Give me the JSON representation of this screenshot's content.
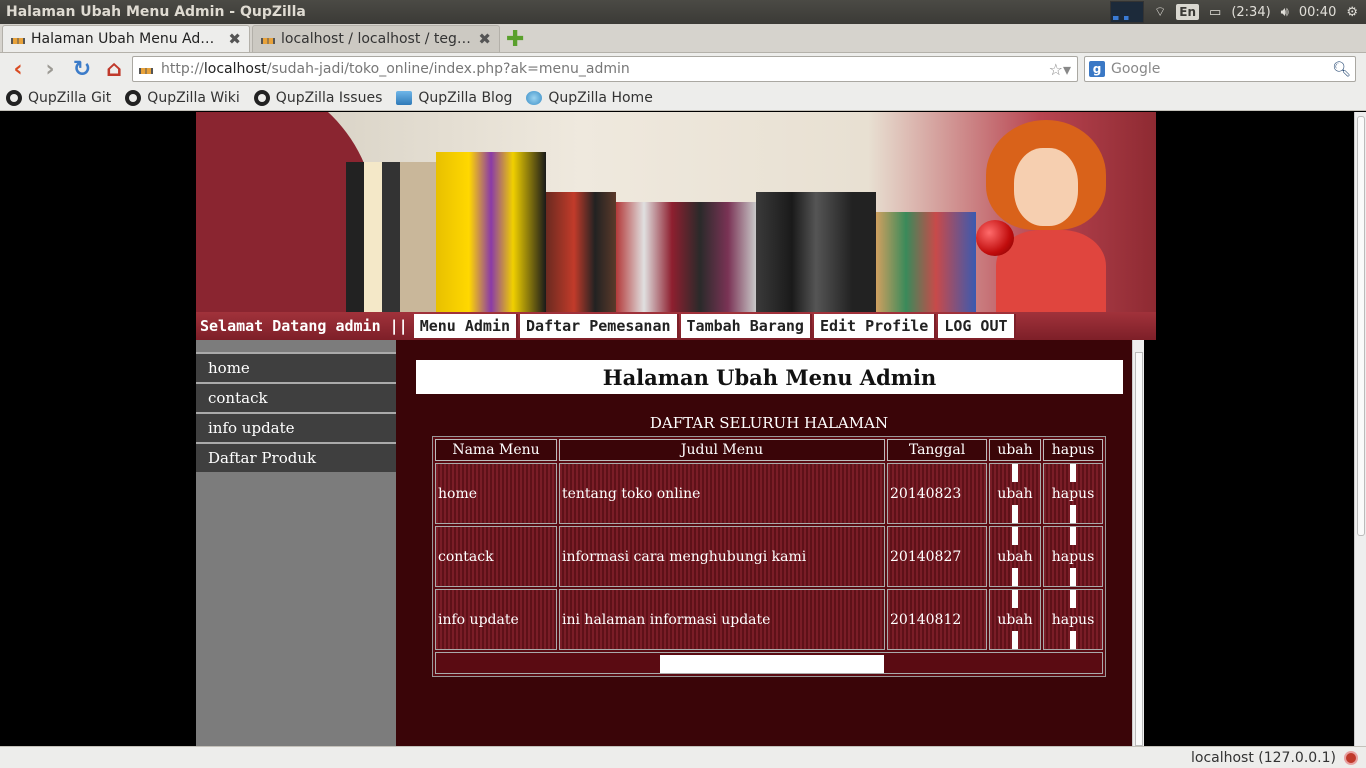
{
  "system": {
    "window_title": "Halaman Ubah Menu Admin - QupZilla",
    "keyboard": "En",
    "battery": "(2:34)",
    "clock": "00:40"
  },
  "tabs": [
    {
      "label": "Halaman Ubah Menu Admin"
    },
    {
      "label": "localhost / localhost / tegu…"
    }
  ],
  "nav": {
    "url_prefix": "http://",
    "url_host": "localhost",
    "url_path": "/sudah-jadi/toko_online/index.php?ak=menu_admin",
    "search_placeholder": "Google"
  },
  "bookmarks": [
    "QupZilla Git",
    "QupZilla Wiki",
    "QupZilla Issues",
    "QupZilla Blog",
    "QupZilla Home"
  ],
  "site": {
    "welcome": "Selamat Datang admin ||",
    "topnav": [
      "Menu Admin",
      "Daftar Pemesanan",
      "Tambah Barang",
      "Edit Profile",
      "LOG OUT"
    ],
    "leftnav": [
      "home",
      "contack",
      "info update",
      "Daftar Produk"
    ],
    "heading": "Halaman Ubah Menu Admin",
    "caption": "DAFTAR SELURUH HALAMAN",
    "table": {
      "headers": [
        "Nama Menu",
        "Judul Menu",
        "Tanggal",
        "ubah",
        "hapus"
      ],
      "rows": [
        {
          "nama": "home",
          "judul": "tentang toko online",
          "tanggal": "20140823",
          "ubah": "ubah",
          "hapus": "hapus"
        },
        {
          "nama": "contack",
          "judul": "informasi cara menghubungi kami",
          "tanggal": "20140827",
          "ubah": "ubah",
          "hapus": "hapus"
        },
        {
          "nama": "info update",
          "judul": "ini halaman informasi update",
          "tanggal": "20140812",
          "ubah": "ubah",
          "hapus": "hapus"
        }
      ]
    }
  },
  "status": {
    "text": "localhost (127.0.0.1)"
  }
}
